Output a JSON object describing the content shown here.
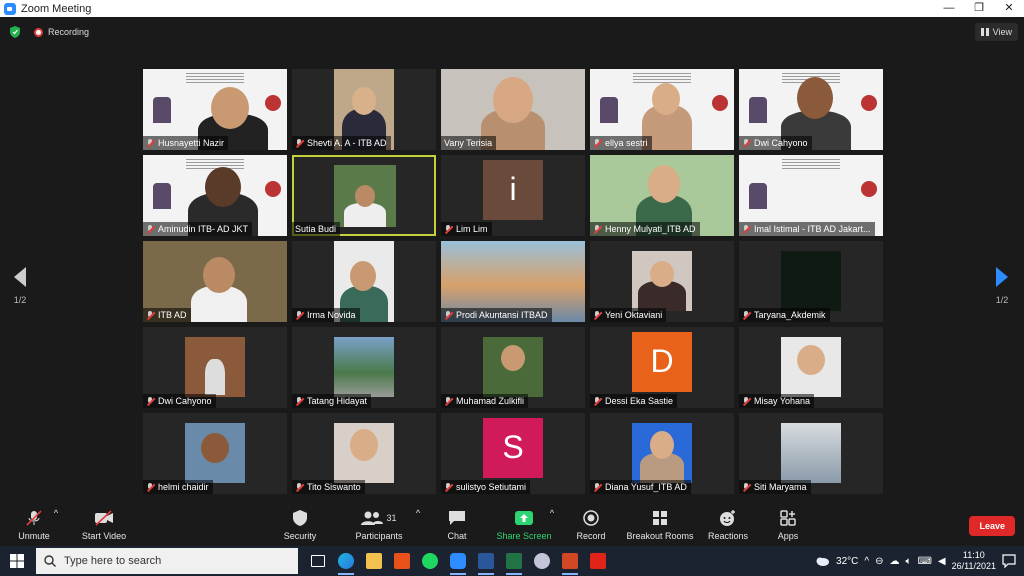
{
  "window": {
    "title": "Zoom Meeting",
    "minimize": "—",
    "restore": "❐",
    "close": "✕"
  },
  "meeting": {
    "recording_label": "Recording",
    "view_label": "View",
    "page_indicator_left": "1/2",
    "page_indicator_right": "1/2"
  },
  "tiles": [
    "Husnayetti Nazir",
    "Shevti A. A - ITB AD",
    "Vany Terisia",
    "ellya sestri",
    "Dwi Cahyono",
    "Aminudin ITB- AD JKT",
    "Sutia Budi",
    "Lim Lim",
    "Henny Mulyati_ITB AD",
    "Imal Istimal - ITB AD Jakart...",
    "ITB AD",
    "Irma Novida",
    "Prodi Akuntansi ITBAD",
    "Yeni Oktaviani",
    "Taryana_Akdemik",
    "Dwi Cahyono",
    "Tatang Hidayat",
    "Muhamad Zulkifli",
    "Dessi Eka Sastie",
    "Misay Yohana",
    "helmi chaidir",
    "Tito Siswanto",
    "sulistyo Setiutami",
    "Diana Yusuf_ITB AD",
    "Siti Maryama"
  ],
  "tile_letters": {
    "lim": "i",
    "dessi": "D",
    "sulistyo": "S"
  },
  "toolbar": {
    "unmute": "Unmute",
    "start_video": "Start Video",
    "security": "Security",
    "participants": "Participants",
    "participants_count": "31",
    "chat": "Chat",
    "share_screen": "Share Screen",
    "record": "Record",
    "breakout_rooms": "Breakout Rooms",
    "reactions": "Reactions",
    "apps": "Apps",
    "leave": "Leave"
  },
  "taskbar": {
    "search_placeholder": "Type here to search",
    "temperature": "32°C",
    "time": "11:10",
    "date": "26/11/2021"
  },
  "colors": {
    "accent": "#2d8cff",
    "leave": "#e02828",
    "active_speaker": "#c5d13a",
    "share": "#2ed573"
  }
}
